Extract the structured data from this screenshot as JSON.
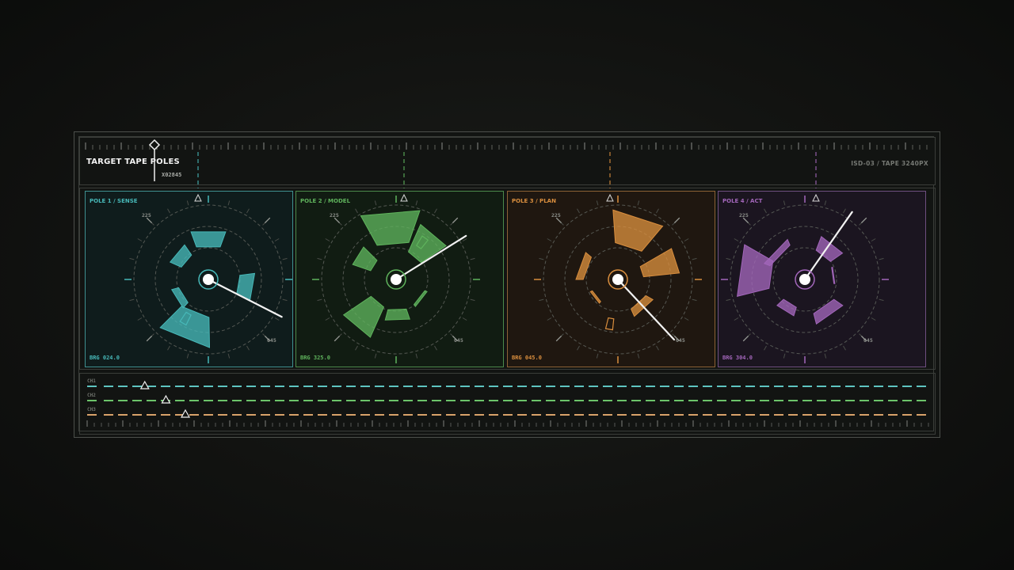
{
  "header": {
    "title": "TARGET TAPE POLES",
    "cursor_readout": "X02845",
    "right_label": "ISD-03 / TAPE 3240PX"
  },
  "panels": [
    {
      "label": "POLE 1 / SENSE",
      "bearing": "BRG 024.0",
      "color": "#47b8b8",
      "bg": "#0f1c1c",
      "border": "#3f8f8f",
      "tick_a": "225",
      "tick_b": "045"
    },
    {
      "label": "POLE 2 / MODEL",
      "bearing": "BRG 325.0",
      "color": "#5fb35c",
      "bg": "#111c12",
      "border": "#4c8a4b",
      "tick_a": "225",
      "tick_b": "045"
    },
    {
      "label": "POLE 3 / PLAN",
      "bearing": "BRG 045.0",
      "color": "#d98e3e",
      "bg": "#1f1710",
      "border": "#8c6235",
      "tick_a": "225",
      "tick_b": "045"
    },
    {
      "label": "POLE 4 / ACT",
      "bearing": "BRG 304.0",
      "color": "#a266ba",
      "bg": "#1b1520",
      "border": "#6f4f80",
      "tick_a": "225",
      "tick_b": "045"
    }
  ],
  "channels": [
    {
      "label": "CH1",
      "color": "#5ec4c0",
      "marker_pos": 0.07
    },
    {
      "label": "CH2",
      "color": "#6cc46a",
      "marker_pos": 0.095
    },
    {
      "label": "CH3",
      "color": "#d9a26a",
      "marker_pos": 0.118
    }
  ]
}
